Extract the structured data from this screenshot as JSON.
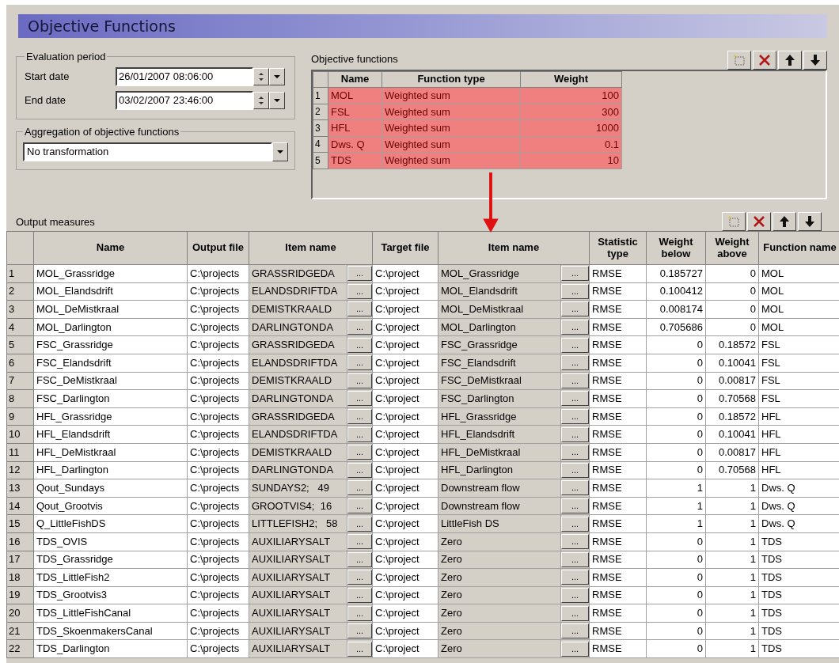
{
  "title": "Objective Functions",
  "evaluation_period": {
    "label": "Evaluation period",
    "start_date": {
      "label": "Start date",
      "value": "26/01/2007 08:06:00"
    },
    "end_date": {
      "label": "End date",
      "value": "03/02/2007 23:46:00"
    }
  },
  "aggregation": {
    "label": "Aggregation of objective functions",
    "value": "No transformation"
  },
  "objective_functions": {
    "label": "Objective functions",
    "columns": [
      "Name",
      "Function type",
      "Weight"
    ],
    "rows": [
      {
        "index": "1",
        "name": "MOL",
        "type": "Weighted sum",
        "weight": "100"
      },
      {
        "index": "2",
        "name": "FSL",
        "type": "Weighted sum",
        "weight": "300"
      },
      {
        "index": "3",
        "name": "HFL",
        "type": "Weighted sum",
        "weight": "1000"
      },
      {
        "index": "4",
        "name": "Dws. Q",
        "type": "Weighted sum",
        "weight": "0.1"
      },
      {
        "index": "5",
        "name": "TDS",
        "type": "Weighted sum",
        "weight": "10"
      }
    ]
  },
  "output_measures": {
    "label": "Output measures",
    "columns": [
      "Name",
      "Output file",
      "Item name",
      "Target file",
      "Item name",
      "Statistic type",
      "Weight below",
      "Weight above",
      "Function name"
    ],
    "rows": [
      {
        "index": "1",
        "name": "MOL_Grassridge",
        "output_file": "C:\\projects",
        "item": "GRASSRIDGEDA",
        "item_button": "...",
        "target_file": "C:\\project",
        "target_item": "MOL_Grassridge",
        "target_button": "...",
        "statistic": "RMSE",
        "weight_below": "0.185727",
        "weight_above": "0",
        "function": "MOL"
      },
      {
        "index": "2",
        "name": "MOL_Elandsdrift",
        "output_file": "C:\\projects",
        "item": "ELANDSDRIFTDA",
        "item_button": "...",
        "target_file": "C:\\project",
        "target_item": "MOL_Elandsdrift",
        "target_button": "...",
        "statistic": "RMSE",
        "weight_below": "0.100412",
        "weight_above": "0",
        "function": "MOL"
      },
      {
        "index": "3",
        "name": "MOL_DeMistkraal",
        "output_file": "C:\\projects",
        "item": "DEMISTKRAALD",
        "item_button": "...",
        "target_file": "C:\\project",
        "target_item": "MOL_DeMistkraal",
        "target_button": "...",
        "statistic": "RMSE",
        "weight_below": "0.008174",
        "weight_above": "0",
        "function": "MOL"
      },
      {
        "index": "4",
        "name": "MOL_Darlington",
        "output_file": "C:\\projects",
        "item": "DARLINGTONDA",
        "item_button": "...",
        "target_file": "C:\\project",
        "target_item": "MOL_Darlington",
        "target_button": "...",
        "statistic": "RMSE",
        "weight_below": "0.705686",
        "weight_above": "0",
        "function": "MOL"
      },
      {
        "index": "5",
        "name": "FSC_Grassridge",
        "output_file": "C:\\projects",
        "item": "GRASSRIDGEDA",
        "item_button": "...",
        "target_file": "C:\\project",
        "target_item": "FSC_Grassridge",
        "target_button": "...",
        "statistic": "RMSE",
        "weight_below": "0",
        "weight_above": "0.18572",
        "function": "FSL"
      },
      {
        "index": "6",
        "name": "FSC_Elandsdrift",
        "output_file": "C:\\projects",
        "item": "ELANDSDRIFTDA",
        "item_button": "...",
        "target_file": "C:\\project",
        "target_item": "FSC_Elandsdrift",
        "target_button": "...",
        "statistic": "RMSE",
        "weight_below": "0",
        "weight_above": "0.10041",
        "function": "FSL"
      },
      {
        "index": "7",
        "name": "FSC_DeMistkraal",
        "output_file": "C:\\projects",
        "item": "DEMISTKRAALD",
        "item_button": "...",
        "target_file": "C:\\project",
        "target_item": "FSC_DeMistkraal",
        "target_button": "...",
        "statistic": "RMSE",
        "weight_below": "0",
        "weight_above": "0.00817",
        "function": "FSL"
      },
      {
        "index": "8",
        "name": "FSC_Darlington",
        "output_file": "C:\\projects",
        "item": "DARLINGTONDA",
        "item_button": "...",
        "target_file": "C:\\project",
        "target_item": "FSC_Darlington",
        "target_button": "...",
        "statistic": "RMSE",
        "weight_below": "0",
        "weight_above": "0.70568",
        "function": "FSL"
      },
      {
        "index": "9",
        "name": "HFL_Grassridge",
        "output_file": "C:\\projects",
        "item": "GRASSRIDGEDA",
        "item_button": "...",
        "target_file": "C:\\project",
        "target_item": "HFL_Grassridge",
        "target_button": "...",
        "statistic": "RMSE",
        "weight_below": "0",
        "weight_above": "0.18572",
        "function": "HFL"
      },
      {
        "index": "10",
        "name": "HFL_Elandsdrift",
        "output_file": "C:\\projects",
        "item": "ELANDSDRIFTDA",
        "item_button": "...",
        "target_file": "C:\\project",
        "target_item": "HFL_Elandsdrift",
        "target_button": "...",
        "statistic": "RMSE",
        "weight_below": "0",
        "weight_above": "0.10041",
        "function": "HFL"
      },
      {
        "index": "11",
        "name": "HFL_DeMistkraal",
        "output_file": "C:\\projects",
        "item": "DEMISTKRAALD",
        "item_button": "...",
        "target_file": "C:\\project",
        "target_item": "HFL_DeMistkraal",
        "target_button": "...",
        "statistic": "RMSE",
        "weight_below": "0",
        "weight_above": "0.00817",
        "function": "HFL"
      },
      {
        "index": "12",
        "name": "HFL_Darlington",
        "output_file": "C:\\projects",
        "item": "DARLINGTONDA",
        "item_button": "...",
        "target_file": "C:\\project",
        "target_item": "HFL_Darlington",
        "target_button": "...",
        "statistic": "RMSE",
        "weight_below": "0",
        "weight_above": "0.70568",
        "function": "HFL"
      },
      {
        "index": "13",
        "name": "Qout_Sundays",
        "output_file": "C:\\projects",
        "item": "SUNDAYS2;   49",
        "item_button": "...",
        "target_file": "C:\\project",
        "target_item": "Downstream flow",
        "target_button": "...",
        "statistic": "RMSE",
        "weight_below": "1",
        "weight_above": "1",
        "function": "Dws. Q"
      },
      {
        "index": "14",
        "name": "Qout_Grootvis",
        "output_file": "C:\\projects",
        "item": "GROOTVIS4;  16",
        "item_button": "...",
        "target_file": "C:\\project",
        "target_item": "Downstream flow",
        "target_button": "...",
        "statistic": "RMSE",
        "weight_below": "1",
        "weight_above": "1",
        "function": "Dws. Q"
      },
      {
        "index": "15",
        "name": "Q_LittleFishDS",
        "output_file": "C:\\projects",
        "item": "LITTLEFISH2;   58",
        "item_button": "...",
        "target_file": "C:\\project",
        "target_item": "LittleFish DS",
        "target_button": "...",
        "statistic": "RMSE",
        "weight_below": "1",
        "weight_above": "1",
        "function": "Dws. Q"
      },
      {
        "index": "16",
        "name": "TDS_OVIS",
        "output_file": "C:\\projects",
        "item": "AUXILIARYSALT",
        "item_button": "...",
        "target_file": "C:\\project",
        "target_item": "Zero",
        "target_button": "...",
        "statistic": "RMSE",
        "weight_below": "0",
        "weight_above": "1",
        "function": "TDS"
      },
      {
        "index": "17",
        "name": "TDS_Grassridge",
        "output_file": "C:\\projects",
        "item": "AUXILIARYSALT",
        "item_button": "...",
        "target_file": "C:\\project",
        "target_item": "Zero",
        "target_button": "...",
        "statistic": "RMSE",
        "weight_below": "0",
        "weight_above": "1",
        "function": "TDS"
      },
      {
        "index": "18",
        "name": "TDS_LittleFish2",
        "output_file": "C:\\projects",
        "item": "AUXILIARYSALT",
        "item_button": "...",
        "target_file": "C:\\project",
        "target_item": "Zero",
        "target_button": "...",
        "statistic": "RMSE",
        "weight_below": "0",
        "weight_above": "1",
        "function": "TDS"
      },
      {
        "index": "19",
        "name": "TDS_Grootvis3",
        "output_file": "C:\\projects",
        "item": "AUXILIARYSALT",
        "item_button": "...",
        "target_file": "C:\\project",
        "target_item": "Zero",
        "target_button": "...",
        "statistic": "RMSE",
        "weight_below": "0",
        "weight_above": "1",
        "function": "TDS"
      },
      {
        "index": "20",
        "name": "TDS_LittleFishCanal",
        "output_file": "C:\\projects",
        "item": "AUXILIARYSALT",
        "item_button": "...",
        "target_file": "C:\\project",
        "target_item": "Zero",
        "target_button": "...",
        "statistic": "RMSE",
        "weight_below": "0",
        "weight_above": "1",
        "function": "TDS"
      },
      {
        "index": "21",
        "name": "TDS_SkoenmakersCanal",
        "output_file": "C:\\projects",
        "item": "AUXILIARYSALT",
        "item_button": "...",
        "target_file": "C:\\project",
        "target_item": "Zero",
        "target_button": "...",
        "statistic": "RMSE",
        "weight_below": "0",
        "weight_above": "1",
        "function": "TDS"
      },
      {
        "index": "22",
        "name": "TDS_Darlington",
        "output_file": "C:\\projects",
        "item": "AUXILIARYSALT",
        "item_button": "...",
        "target_file": "C:\\project",
        "target_item": "Zero",
        "target_button": "...",
        "statistic": "RMSE",
        "weight_below": "0",
        "weight_above": "1",
        "function": "TDS"
      }
    ]
  }
}
